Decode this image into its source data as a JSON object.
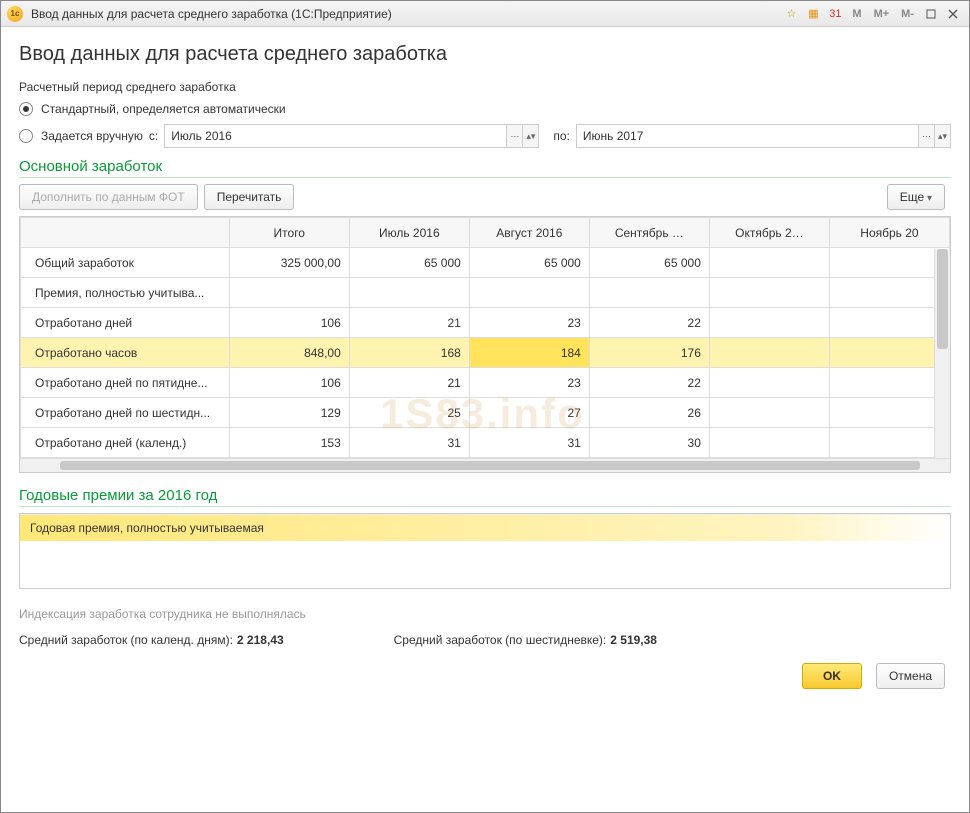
{
  "window": {
    "title": "Ввод данных для расчета среднего заработка  (1С:Предприятие)",
    "m_buttons": [
      "M",
      "M+",
      "M-"
    ]
  },
  "page": {
    "heading": "Ввод данных для расчета среднего заработка",
    "period_label": "Расчетный период среднего заработка",
    "radio_auto": "Стандартный, определяется автоматически",
    "radio_manual": "Задается вручную",
    "from_lbl": "с:",
    "to_lbl": "по:",
    "date_from": "Июль 2016",
    "date_to": "Июнь 2017",
    "main_earn_head": "Основной заработок",
    "btn_fill": "Дополнить по данным ФОТ",
    "btn_recalc": "Перечитать",
    "btn_more": "Еще",
    "bonus_head": "Годовые премии за 2016 год",
    "bonus_row": "Годовая премия, полностью учитываемая",
    "indexation_note": "Индексация заработка сотрудника не выполнялась",
    "avg_cal_lbl": "Средний заработок (по календ. дням):",
    "avg_cal_val": "2 218,43",
    "avg_six_lbl": "Средний заработок (по шестидневке):",
    "avg_six_val": "2 519,38",
    "ok": "OK",
    "cancel": "Отмена"
  },
  "table": {
    "headers": [
      "",
      "Итого",
      "Июль 2016",
      "Август 2016",
      "Сентябрь …",
      "Октябрь 2…",
      "Ноябрь 20"
    ],
    "rows": [
      {
        "label": "Общий заработок",
        "total": "325 000,00",
        "m": [
          "65 000",
          "65 000",
          "65 000",
          "",
          ""
        ]
      },
      {
        "label": "Премия, полностью учитыва...",
        "total": "",
        "m": [
          "",
          "",
          "",
          "",
          ""
        ]
      },
      {
        "label": "Отработано дней",
        "total": "106",
        "m": [
          "21",
          "23",
          "22",
          "",
          ""
        ]
      },
      {
        "label": "Отработано часов",
        "total": "848,00",
        "m": [
          "168",
          "184",
          "176",
          "",
          ""
        ],
        "hl": true,
        "sel": 1
      },
      {
        "label": "Отработано дней по пятидне...",
        "total": "106",
        "m": [
          "21",
          "23",
          "22",
          "",
          ""
        ]
      },
      {
        "label": "Отработано дней по шестидн...",
        "total": "129",
        "m": [
          "25",
          "27",
          "26",
          "",
          ""
        ]
      },
      {
        "label": "Отработано дней (календ.)",
        "total": "153",
        "m": [
          "31",
          "31",
          "30",
          "",
          ""
        ]
      }
    ]
  },
  "watermark": "1S83.info"
}
